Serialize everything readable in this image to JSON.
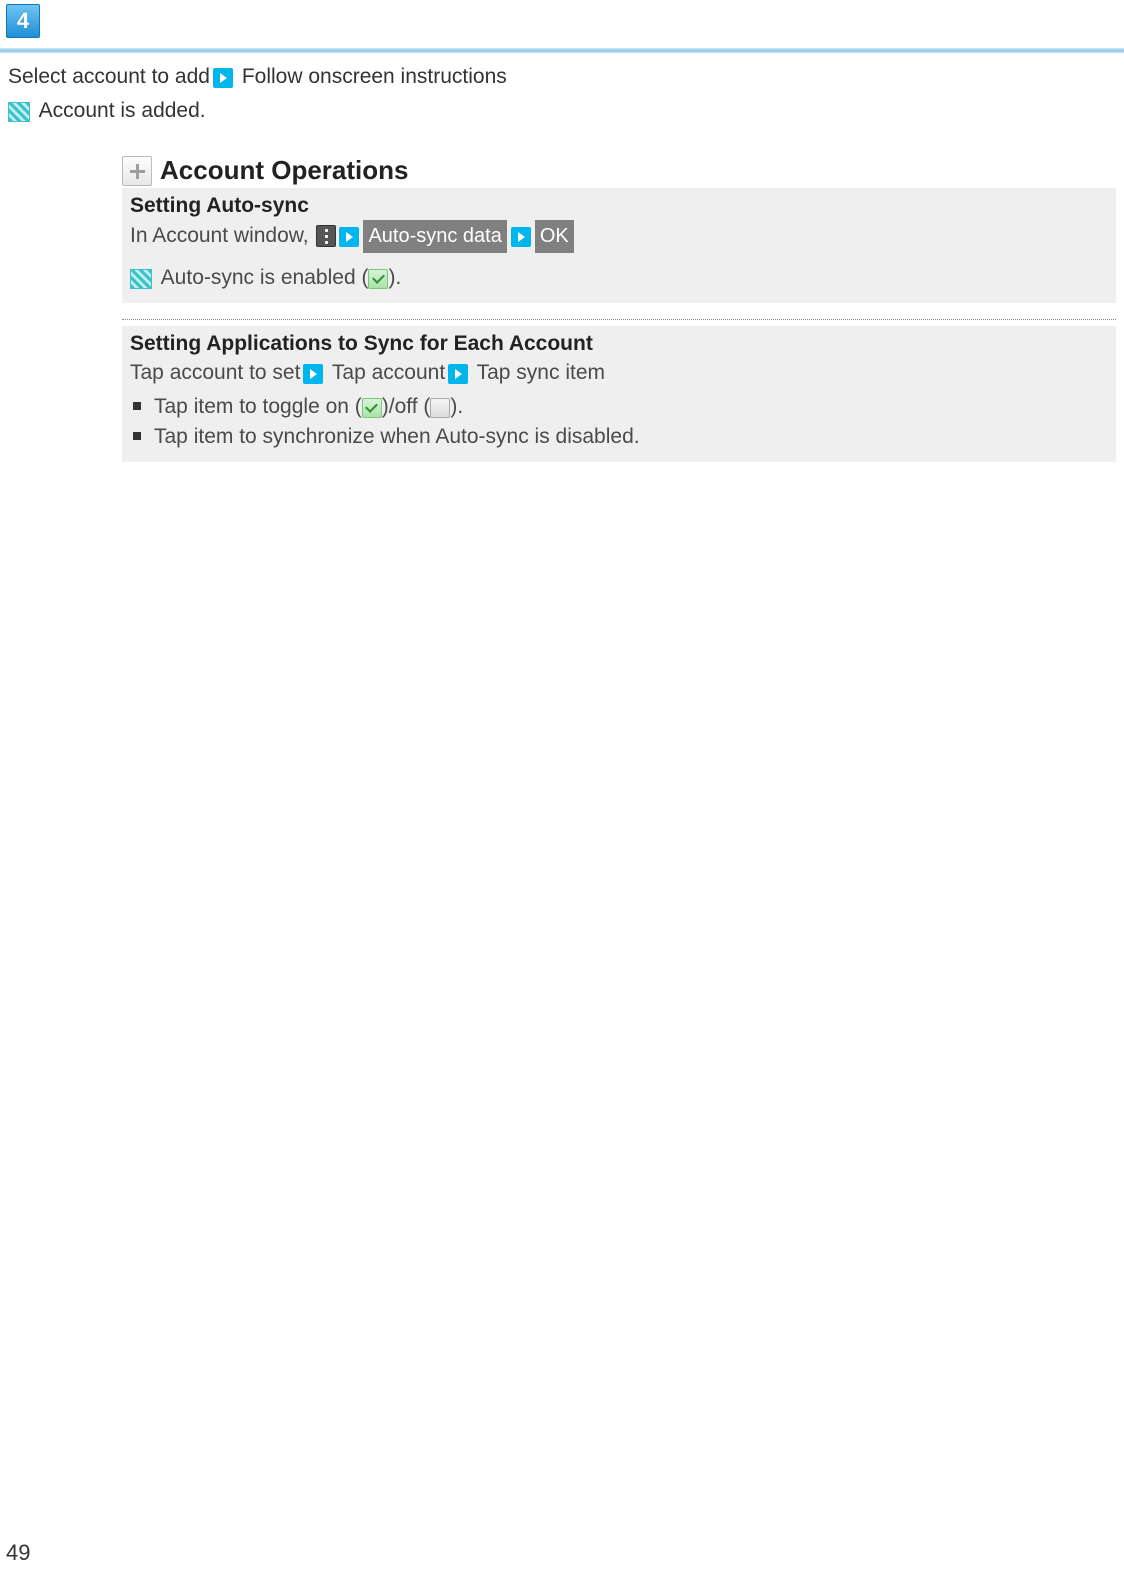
{
  "step": {
    "number": "4"
  },
  "line1": {
    "t1": "Select account to add",
    "t2": " Follow onscreen instructions"
  },
  "line2": {
    "t1": " Account is added."
  },
  "section": {
    "title": "Account Operations",
    "autosync": {
      "heading": "Setting Auto-sync",
      "prefix": "In Account window, ",
      "btn1": "Auto-sync data",
      "btn2": "OK",
      "enabled_prefix": " Auto-sync is enabled (",
      "enabled_suffix": ")."
    },
    "perapp": {
      "heading": "Setting Applications to Sync for Each Account",
      "flow_t1": "Tap account to set",
      "flow_t2": " Tap account",
      "flow_t3": " Tap sync item",
      "li1_a": "Tap item to toggle on (",
      "li1_b": ")/off (",
      "li1_c": ").",
      "li2": "Tap item to synchronize when Auto-sync is disabled."
    }
  },
  "pageNumber": "49"
}
